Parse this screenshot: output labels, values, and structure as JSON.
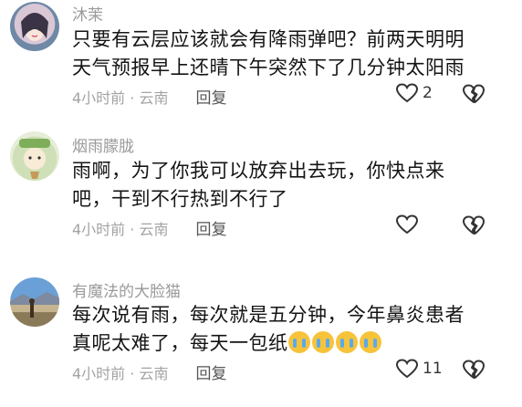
{
  "comments": [
    {
      "username": "沐茉",
      "text_line1": "只要有云层应该就会有降雨弹吧？前两天明明",
      "text_line2": "天气预报早上还晴下午突然下了几分钟太阳雨",
      "time_location": "4小时前 · 云南",
      "reply_label": "回复",
      "like_count": "2"
    },
    {
      "username": "烟雨朦胧",
      "text_line1": "雨啊，为了你我可以放弃出去玩，你快点来",
      "text_line2": "吧，干到不行热到不行了",
      "time_location": "4小时前 · 云南",
      "reply_label": "回复",
      "like_count": ""
    },
    {
      "username": "有魔法的大脸猫",
      "text_line1": "每次说有雨，每次就是五分钟，今年鼻炎患者",
      "text_line2": "真呢太难了，每天一包纸",
      "emoji": "crying-emoji",
      "emoji_count": 4,
      "time_location": "4小时前 · 云南",
      "reply_label": "回复",
      "like_count": "11"
    }
  ],
  "icons": {
    "like": "heart-outline-icon",
    "dislike": "broken-heart-icon"
  },
  "colors": {
    "username": "#9a9a9a",
    "meta": "#a3a3a3",
    "text": "#141414"
  }
}
